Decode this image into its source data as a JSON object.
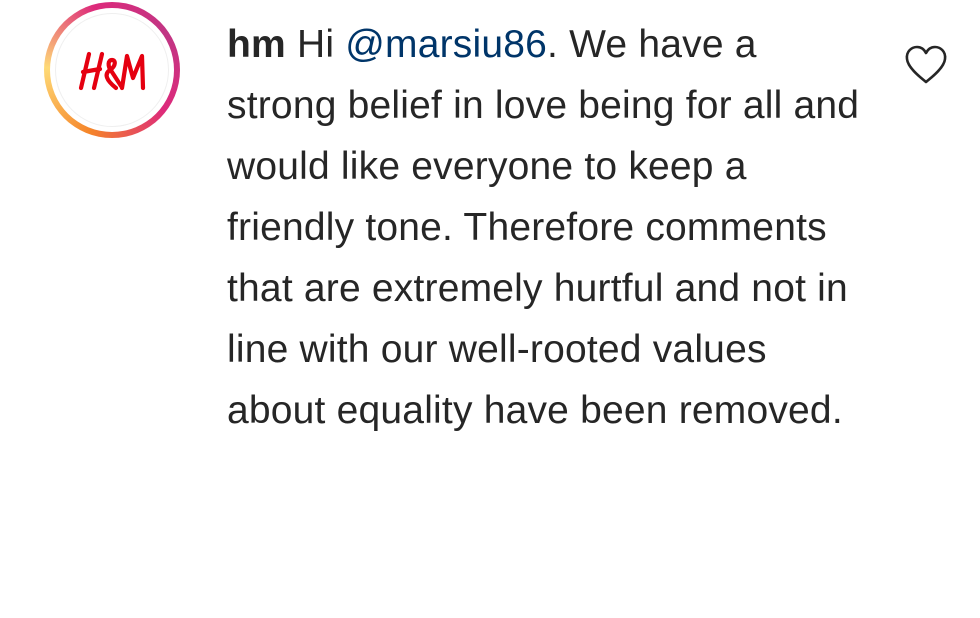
{
  "comment": {
    "avatar_logo_text": "H&M",
    "username": "hm",
    "greeting": "Hi",
    "mention": "@marsiu86",
    "text": ". We have a strong belief in love being for all and would like everyone to keep a friendly tone. Therefore comments that are extremely hurtful and not in line with our well-rooted values about equality have been removed.",
    "like_icon": "heart-outline-icon"
  },
  "colors": {
    "text": "#262626",
    "mention": "#003569",
    "brand_red": "#e50010",
    "ring_gradient": [
      "#f58529",
      "#feda77",
      "#dd2a7b",
      "#c13584"
    ]
  }
}
